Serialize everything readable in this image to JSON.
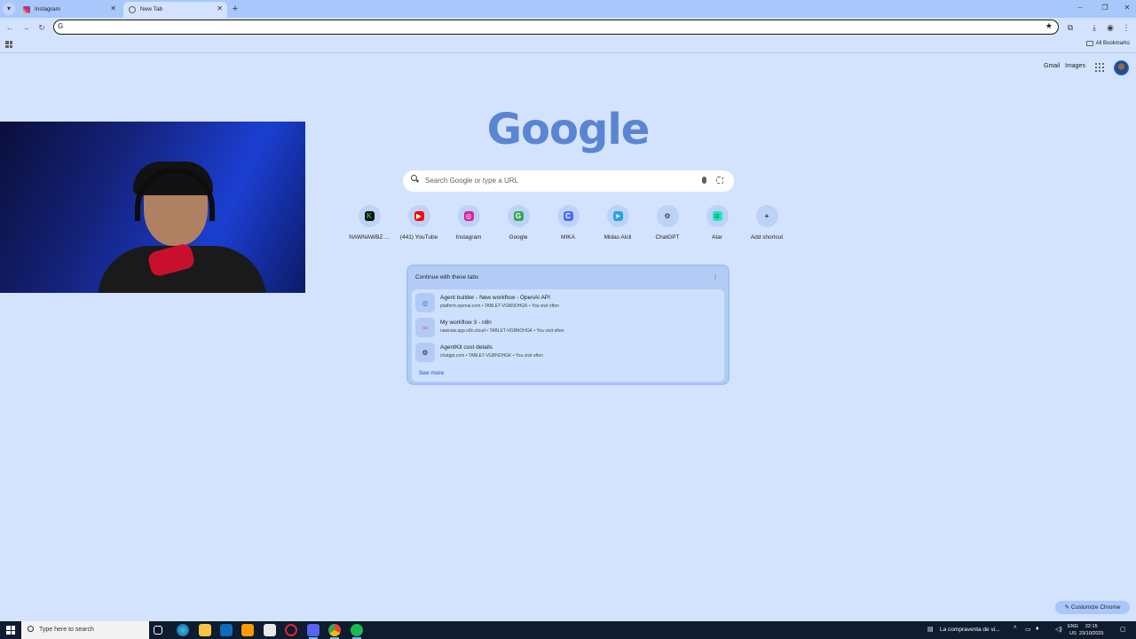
{
  "browser": {
    "tabs": [
      {
        "title": "Instagram",
        "favicon_color": "#e1306c",
        "active": false
      },
      {
        "title": "New Tab",
        "favicon_color": "#5f6368",
        "active": true
      }
    ],
    "omnibox": {
      "value": "",
      "placeholder": ""
    },
    "bookmarks": {
      "all_bookmarks_label": "All Bookmarks"
    }
  },
  "ntp": {
    "header_links": {
      "gmail": "Gmail",
      "images": "Images"
    },
    "logo": "Google",
    "search_placeholder": "Search Google or type a URL",
    "shortcuts": [
      {
        "label": "NAWNAWBZ ...",
        "icon": "K",
        "color": "#00d26a",
        "bg": "#0b0b0b"
      },
      {
        "label": "(441) YouTube",
        "icon": "▶",
        "color": "#ffffff",
        "bg": "#ff0000"
      },
      {
        "label": "Instagram",
        "icon": "◎",
        "color": "#ffffff",
        "bg": "#d6249f"
      },
      {
        "label": "Google",
        "icon": "G",
        "color": "#ffffff",
        "bg": "#34a853"
      },
      {
        "label": "MIKA",
        "icon": "C",
        "color": "#ffffff",
        "bg": "#4b6cf7"
      },
      {
        "label": "Midas Alcli",
        "icon": "➤",
        "color": "#ffffff",
        "bg": "#2aa3dc"
      },
      {
        "label": "ChatGPT",
        "icon": "⚙",
        "color": "#1f1f1f",
        "bg": "transparent"
      },
      {
        "label": "Atar",
        "icon": "☺",
        "color": "#0b0b0b",
        "bg": "#1de9b6"
      },
      {
        "label": "Add shortcut",
        "icon": "+",
        "color": "#1f1f1f",
        "bg": "transparent"
      }
    ],
    "continue_card": {
      "title": "Continue with these tabs",
      "items": [
        {
          "title": "Agent builder - New workflow - OpenAI API",
          "subtitle": "platform.openai.com • TABLET-VGBNOHGK • You visit often",
          "icon": "◎"
        },
        {
          "title": "My workflow 3 - n8n",
          "subtitle": "nawnaw.app.n8n.cloud • TABLET-VGBNOHGK • You visit often",
          "icon": "∞"
        },
        {
          "title": "AgentKit cost details",
          "subtitle": "chatgpt.com • TABLET-VGBNOHGK • You visit often",
          "icon": "⚙"
        }
      ],
      "see_more": "See more"
    },
    "customize_label": "Customize Chrome"
  },
  "taskbar": {
    "search_placeholder": "Type here to search",
    "tray_news": "La compraventa de vi...",
    "lang_top": "ENG",
    "lang_bottom": "US",
    "time": "22:15",
    "date": "23/10/2025"
  }
}
